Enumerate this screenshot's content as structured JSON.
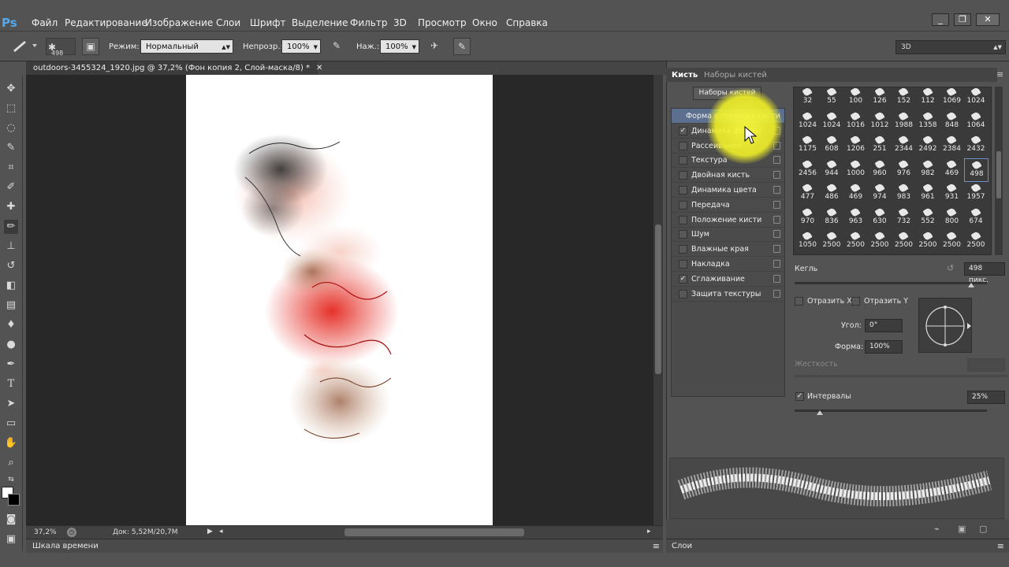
{
  "app": {
    "logo": "Ps"
  },
  "menu": [
    "Файл",
    "Редактирование",
    "Изображение",
    "Слои",
    "Шрифт",
    "Выделение",
    "Фильтр",
    "3D",
    "Просмотр",
    "Окно",
    "Справка"
  ],
  "window_buttons": [
    "_",
    "❐",
    "✕"
  ],
  "options": {
    "brush_size": "498",
    "mode_label": "Режим:",
    "mode_value": "Нормальный",
    "opacity_label": "Непрозр.:",
    "opacity_value": "100%",
    "pressure_label": "Наж.:",
    "pressure_value": "100%",
    "workspace": "3D"
  },
  "document": {
    "tab_title": "outdoors-3455324_1920.jpg @ 37,2% (Фон копия 2, Слой-маска/8) *",
    "zoom": "37,2%",
    "doc_info": "Док: 5,52M/20,7M"
  },
  "timeline_label": "Шкала времени",
  "layers_label": "Слои",
  "brush_panel": {
    "tab_brush": "Кисть",
    "tab_presets": "Наборы кистей",
    "presets_button": "Наборы кистей",
    "options": [
      {
        "label": "Форма отпечатка кисти",
        "checked": false,
        "lock": false,
        "active": true
      },
      {
        "label": "Динамика формы",
        "checked": true,
        "lock": true
      },
      {
        "label": "Рассеивание",
        "checked": false,
        "lock": true
      },
      {
        "label": "Текстура",
        "checked": false,
        "lock": true
      },
      {
        "label": "Двойная кисть",
        "checked": false,
        "lock": true
      },
      {
        "label": "Динамика цвета",
        "checked": false,
        "lock": true
      },
      {
        "label": "Передача",
        "checked": false,
        "lock": true
      },
      {
        "label": "Положение кисти",
        "checked": false,
        "lock": true
      },
      {
        "label": "Шум",
        "checked": false,
        "lock": true
      },
      {
        "label": "Влажные края",
        "checked": false,
        "lock": true
      },
      {
        "label": "Накладка",
        "checked": false,
        "lock": true
      },
      {
        "label": "Сглаживание",
        "checked": true,
        "lock": true
      },
      {
        "label": "Защита текстуры",
        "checked": false,
        "lock": true
      }
    ],
    "brush_sizes": [
      [
        "32",
        "55",
        "100",
        "126",
        "152",
        "112",
        "1069",
        "1024"
      ],
      [
        "1024",
        "1024",
        "1016",
        "1012",
        "1988",
        "1358",
        "848",
        "1064"
      ],
      [
        "1175",
        "608",
        "1206",
        "251",
        "2344",
        "2492",
        "2384",
        "2432"
      ],
      [
        "2456",
        "944",
        "1000",
        "960",
        "976",
        "982",
        "469",
        "498"
      ],
      [
        "477",
        "486",
        "469",
        "974",
        "983",
        "961",
        "931",
        "1957"
      ],
      [
        "970",
        "836",
        "963",
        "630",
        "732",
        "552",
        "800",
        "674"
      ],
      [
        "1050",
        "2500",
        "2500",
        "2500",
        "2500",
        "2500",
        "2500",
        "2500"
      ]
    ],
    "selected_brush": "498",
    "size_label": "Кегль",
    "size_value": "498 пикс.",
    "size_level": 0.92,
    "flip_x": "Отразить X",
    "flip_y": "Отразить Y",
    "angle_label": "Угол:",
    "angle_value": "0°",
    "roundness_label": "Форма:",
    "roundness_value": "100%",
    "hardness_label": "Жесткость",
    "spacing_label": "Интервалы",
    "spacing_value": "25%",
    "spacing_level": 0.13
  },
  "colors": {
    "accent": "#6b91c4",
    "highlight": "#f2f234"
  }
}
